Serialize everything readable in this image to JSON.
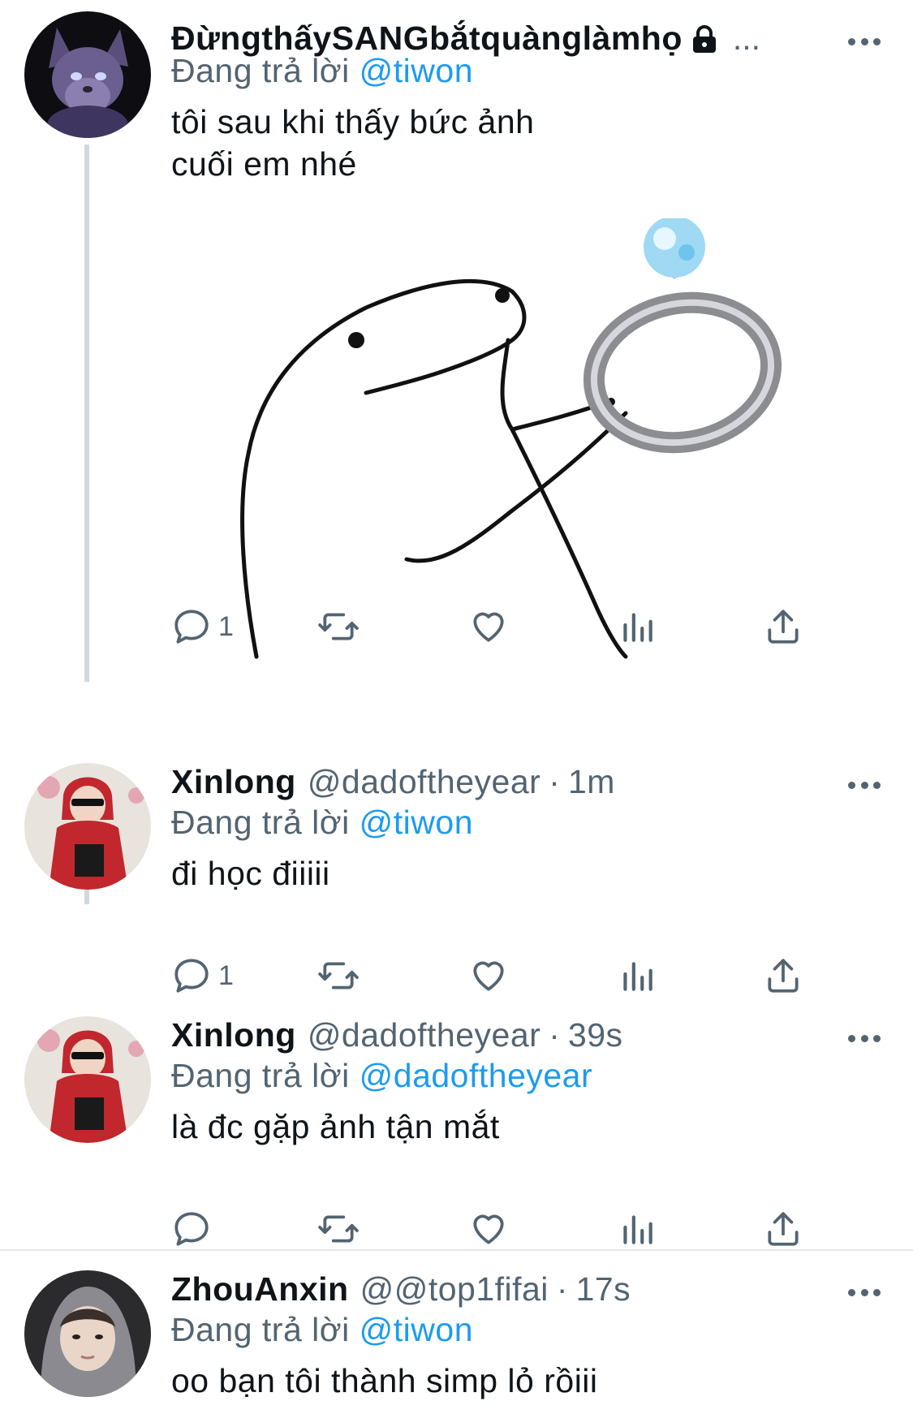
{
  "colors": {
    "accent": "#1d9bf0",
    "secondary_text": "#536471",
    "primary_text": "#0f1419",
    "thread_line": "#cfd9de"
  },
  "reply_prefix": "Đang trả lời",
  "tweets": [
    {
      "name": "ĐừngthấySANGbắtquànglàmhọ",
      "handle": "",
      "time": "",
      "locked": true,
      "name_overflow": "...",
      "reply_to": "@tiwon",
      "text": "tôi sau khi thấy bức ảnh\ncuối em nhé",
      "avatar_icon": "dark-wolf-character-icon",
      "media_icon": "blob-holding-ring-meme",
      "reply_count": "1"
    },
    {
      "name": "Xinlong",
      "handle": "@dadoftheyear",
      "time": "1m",
      "reply_to": "@tiwon",
      "text": "đi học điiiii",
      "avatar_icon": "person-red-hoodie-icon",
      "reply_count": "1"
    },
    {
      "name": "Xinlong",
      "handle": "@dadoftheyear",
      "time": "39s",
      "reply_to": "@dadoftheyear",
      "text": "là đc gặp ảnh tận mắt",
      "avatar_icon": "person-red-hoodie-icon",
      "reply_count": ""
    },
    {
      "name": "ZhouAnxin",
      "handle": "@@top1fifai",
      "time": "17s",
      "reply_to": "@tiwon",
      "text": "oo bạn tôi thành simp lỏ rồiii",
      "avatar_icon": "person-grey-hood-icon"
    }
  ]
}
